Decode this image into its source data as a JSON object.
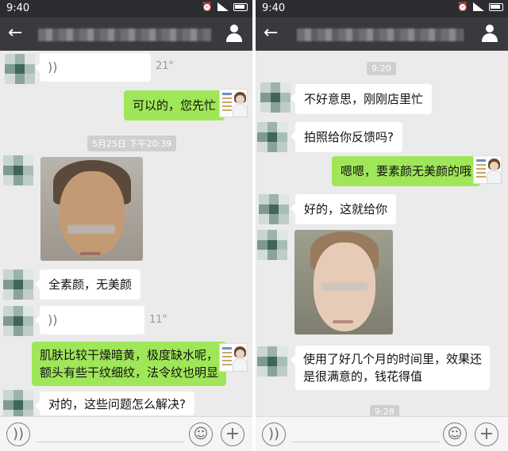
{
  "left": {
    "status_time": "9:40",
    "messages": {
      "voice_top_duration": "21\"",
      "out_1": "可以的，您先忙",
      "timestamp_1": "5月25日 下午20:39",
      "in_text_1": "全素颜，无美颜",
      "voice_mid_duration": "11\"",
      "out_2_line1": "肌肤比较干燥暗黄，极度缺水呢，",
      "out_2_line2": "额头有些干纹细纹，法令纹也明显",
      "in_text_2": "对的，这些问题怎么解决?"
    }
  },
  "right": {
    "status_time": "9:40",
    "messages": {
      "timestamp_1": "9:20",
      "in_1": "不好意思，刚刚店里忙",
      "in_2": "拍照给你反馈吗?",
      "out_1": "嗯嗯，要素颜无美颜的哦",
      "in_3": "好的，这就给你",
      "in_4_line1": "使用了好几个月的时间里，效果还",
      "in_4_line2": "是很满意的，钱花得值",
      "timestamp_2": "9:28"
    }
  },
  "icons": {
    "back": "arrow-left-icon",
    "contact": "person-icon",
    "voice_toggle": "voice-icon",
    "emoji": "emoji-icon",
    "more": "plus-icon"
  },
  "glyphs": {
    "back": "←",
    "voice": "))",
    "emoji": "☺",
    "plus": "+"
  },
  "colors": {
    "chat_background": "#ebebeb",
    "titlebar": "#393a3f",
    "outgoing_bubble": "#9fe658",
    "incoming_bubble": "#ffffff"
  }
}
